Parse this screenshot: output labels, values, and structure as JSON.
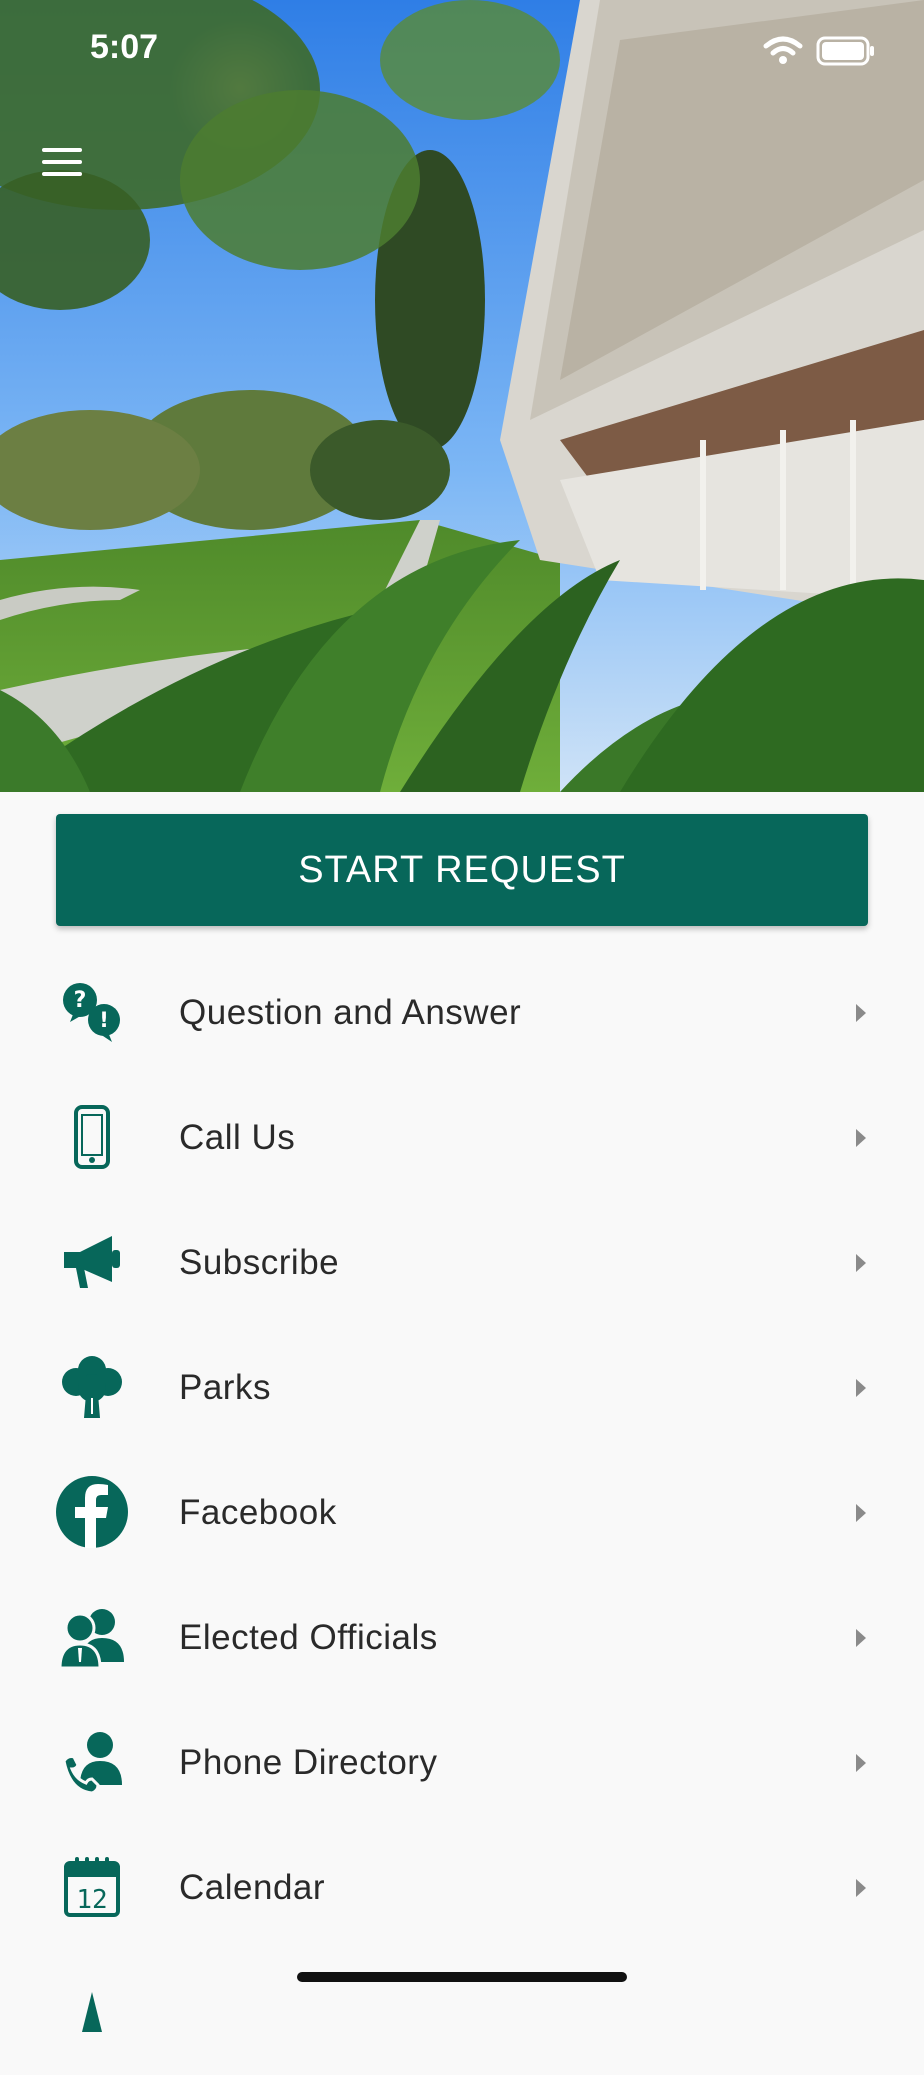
{
  "status_bar": {
    "time": "5:07"
  },
  "primary_action": {
    "label": "START REQUEST"
  },
  "menu": {
    "items": [
      {
        "label": "Question and Answer",
        "icon": "question-answer-icon"
      },
      {
        "label": "Call Us",
        "icon": "mobile-phone-icon"
      },
      {
        "label": "Subscribe",
        "icon": "megaphone-icon"
      },
      {
        "label": "Parks",
        "icon": "tree-icon"
      },
      {
        "label": "Facebook",
        "icon": "facebook-icon"
      },
      {
        "label": "Elected Officials",
        "icon": "people-icon"
      },
      {
        "label": "Phone Directory",
        "icon": "phone-contact-icon"
      },
      {
        "label": "Calendar",
        "icon": "calendar-icon"
      }
    ]
  },
  "colors": {
    "accent": "#07675a",
    "background": "#f9f9f9",
    "text": "#2a2a2a"
  }
}
